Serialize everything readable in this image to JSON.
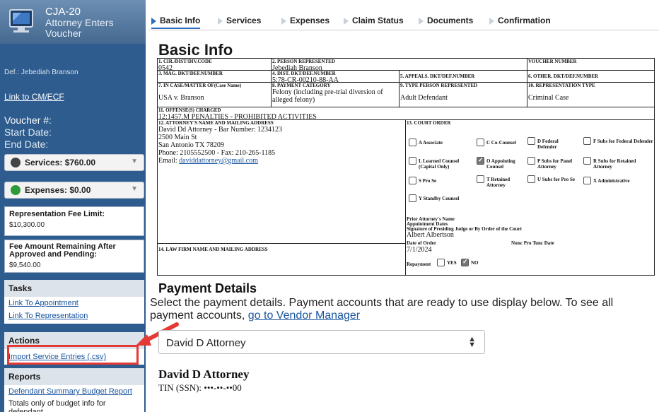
{
  "app": {
    "code": "CJA-20",
    "title_line1": "Attorney Enters",
    "title_line2": "Voucher"
  },
  "sidebar": {
    "defendant": "Def.: Jebediah Branson",
    "cmecf_link": "Link to CM/ECF",
    "voucher_label": "Voucher #:",
    "start_label": "Start Date:",
    "end_label": "End Date:",
    "services": "Services: $760.00",
    "expenses": "Expenses: $0.00",
    "fee_limit_label": "Representation Fee Limit:",
    "fee_limit_value": "$10,300.00",
    "remaining_label": "Fee Amount Remaining After Approved and Pending:",
    "remaining_value": "$9,540.00",
    "tasks_header": "Tasks",
    "tasks": [
      "Link To Appointment",
      "Link To Representation"
    ],
    "actions_header": "Actions",
    "action_import": "Import Service Entries (.csv)",
    "reports_header": "Reports",
    "report_link": "Defendant Summary Budget Report",
    "report_note": "Totals only of budget info for defendant"
  },
  "tabs": [
    {
      "label": "Basic Info",
      "active": true
    },
    {
      "label": "Services",
      "active": false
    },
    {
      "label": "Expenses",
      "active": false
    },
    {
      "label": "Claim Status",
      "active": false
    },
    {
      "label": "Documents",
      "active": false
    },
    {
      "label": "Confirmation",
      "active": false
    }
  ],
  "page_title": "Basic Info",
  "form": {
    "f1": {
      "label": "1. CIR./DIST/DIV.CODE",
      "value": "0542"
    },
    "f2": {
      "label": "2. PERSON REPRESENTED",
      "value": "Jebediah Branson"
    },
    "voucher": {
      "label": "VOUCHER NUMBER",
      "value": ""
    },
    "f3": {
      "label": "3. MAG. DKT/DEF.NUMBER",
      "value": ""
    },
    "f4": {
      "label": "4. DIST. DKT/DEF.NUMBER",
      "value": "5:78-CR-00210-88-AA"
    },
    "f5": {
      "label": "5. APPEALS. DKT/DEF.NUMBER",
      "value": ""
    },
    "f6": {
      "label": "6. OTHER. DKT/DEF.NUMBER",
      "value": ""
    },
    "f7": {
      "label": "7. IN CASE/MATTER OF(Case Name)",
      "value": "USA v. Branson"
    },
    "f8": {
      "label": "8. PAYMENT CATEGORY",
      "value": "Felony (including pre-trial diversion of alleged felony)"
    },
    "f9": {
      "label": "9. TYPE PERSON REPRESENTED",
      "value": "Adult Defendant"
    },
    "f10": {
      "label": "10. REPRESENTATION TYPE",
      "value": "Criminal Case"
    },
    "f11": {
      "label": "11. OFFENSE(S) CHARGED",
      "value": "12:1457.M PENALTIES - PROHIBITED ACTIVITIES"
    },
    "f12": {
      "label": "12. ATTORNEY'S NAME AND MAILING ADDRESS",
      "line1": "David Dd Attorney - Bar Number: 1234123",
      "line2": "2500 Main St",
      "line3": "San Antonio TX 78209",
      "line4": "Phone: 2105552500 - Fax: 210-265-1185",
      "email_label": "Email: ",
      "email": "daviddattorney@gmail.com"
    },
    "f13": {
      "label": "13. COURT ORDER",
      "options": [
        {
          "text": "A Associate",
          "checked": false
        },
        {
          "text": "C Co-Counsel",
          "checked": false
        },
        {
          "text": "D Federal Defender",
          "checked": false
        },
        {
          "text": "F Subs for Federal Defender",
          "checked": false
        },
        {
          "text": "L Learned Counsel (Capital Only)",
          "checked": false
        },
        {
          "text": "O Appointing Counsel",
          "checked": true
        },
        {
          "text": "P Subs for Panel Attorney",
          "checked": false
        },
        {
          "text": "R Subs for Retained Attorney",
          "checked": false
        },
        {
          "text": "S Pro Se",
          "checked": false
        },
        {
          "text": "T Retained Attorney",
          "checked": false
        },
        {
          "text": "U Subs for Pro Se",
          "checked": false
        },
        {
          "text": "X Administrative",
          "checked": false
        },
        {
          "text": "Y Standby Counsel",
          "checked": false
        }
      ],
      "prior_label_1": "Prior Attorney's Name",
      "prior_label_2": "Appointment Dates",
      "signature_label": "Signature of Presiding Judge or By Order of the Court",
      "judge": "Albert Albertson",
      "date_label": "Date of Order",
      "date_value": "7/1/2024",
      "nunc_label": "Nunc Pro Tunc Date",
      "repayment_label": "Repayment",
      "yes_label": "YES",
      "no_label": "NO",
      "repayment_yes": false,
      "repayment_no": true
    },
    "f14": {
      "label": "14. LAW FIRM NAME AND MAILING ADDRESS",
      "value": ""
    }
  },
  "payment": {
    "title": "Payment Details",
    "desc": "Select the payment details. Payment accounts that are ready to use display below. To see all payment accounts, ",
    "link": "go to Vendor Manager",
    "selected_vendor": "David D Attorney",
    "vendor_name": "David D Attorney",
    "tin": "TIN (SSN): •••-••-••00"
  },
  "colors": {
    "sidebar": "#2e5c8e",
    "accent": "#2e6cbf",
    "callout": "#e53935",
    "link": "#1a55a0"
  }
}
